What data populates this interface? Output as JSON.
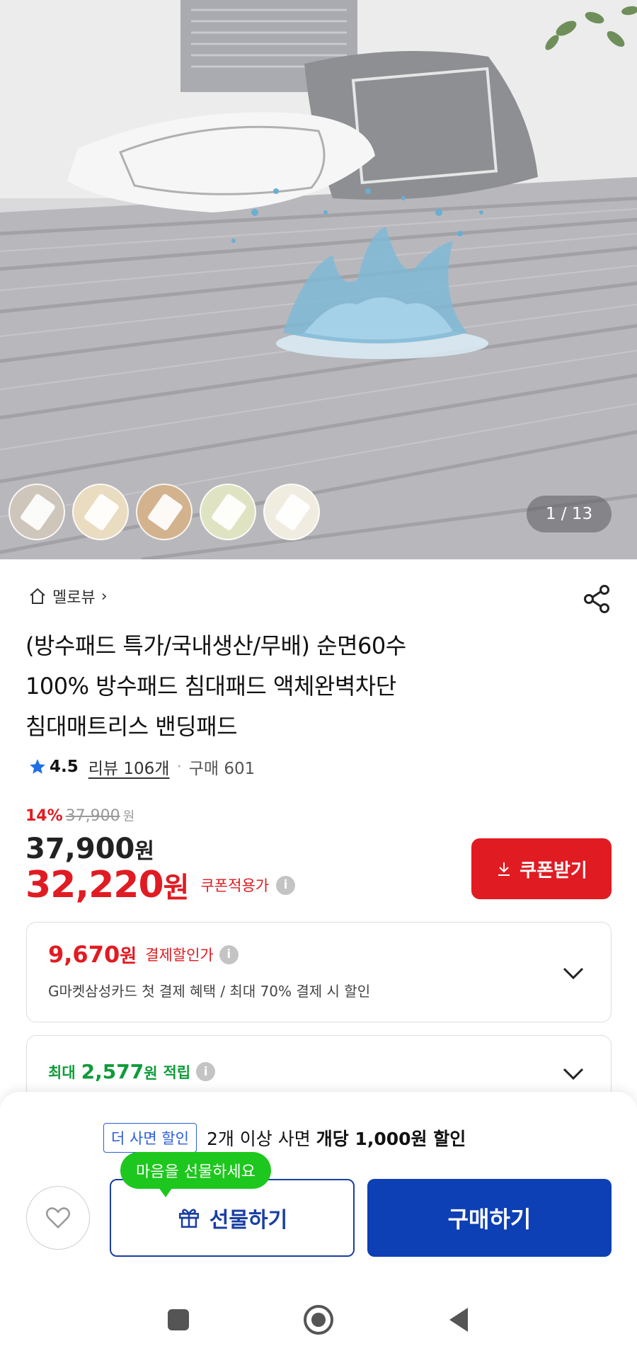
{
  "hero": {
    "page_indicator": "1 / 13",
    "thumbnails": [
      {
        "color": "#cfc6bb"
      },
      {
        "color": "#e9dcc0"
      },
      {
        "color": "#d3b28e"
      },
      {
        "color": "#dfe3c2"
      },
      {
        "color": "#f1ece0"
      }
    ]
  },
  "store": {
    "name": "멜로뷰",
    "arrow": "›"
  },
  "product": {
    "title_lines": [
      "(방수패드 특가/국내생산/무배) 순면60수",
      "100% 방수패드 침대패드 액체완벽차단",
      "침대매트리스 밴딩패드"
    ]
  },
  "rating": {
    "score": "4.5",
    "review_label": "리뷰 106개",
    "separator": "·",
    "purchase_label": "구매 601"
  },
  "price": {
    "discount_pct": "14%",
    "original": "37,900",
    "original_unit": "원",
    "current": "37,900",
    "current_unit": "원",
    "coupon_price": "32,220",
    "coupon_unit": "원",
    "coupon_label": "쿠폰적용가",
    "coupon_button": "쿠폰받기"
  },
  "payment_card": {
    "amount": "9,670",
    "unit": "원",
    "label": "결제할인가",
    "desc": "G마켓삼성카드 첫 결제 혜택 / 최대 70% 결제 시 할인"
  },
  "points_card": {
    "prefix": "최대",
    "amount": "2,577",
    "unit": "원",
    "suffix": "적립"
  },
  "bottom": {
    "promo_tag": "더 사면 할인",
    "promo_text": "2개 이상 사면",
    "promo_bold": "개당 1,000원 할인",
    "gift_bubble": "마음을 선물하세요",
    "gift_button": "선물하기",
    "buy_button": "구매하기"
  },
  "colors": {
    "accent_red": "#e11b22",
    "primary_blue": "#0d3fb5",
    "green": "#0f9b3a",
    "bubble_green": "#1ec71e"
  },
  "icons": [
    "home-icon",
    "share-icon",
    "star-icon",
    "info-icon",
    "download-icon",
    "chevron-down-icon",
    "heart-icon",
    "gift-icon",
    "nav-square-icon",
    "nav-home-icon",
    "nav-back-icon"
  ]
}
